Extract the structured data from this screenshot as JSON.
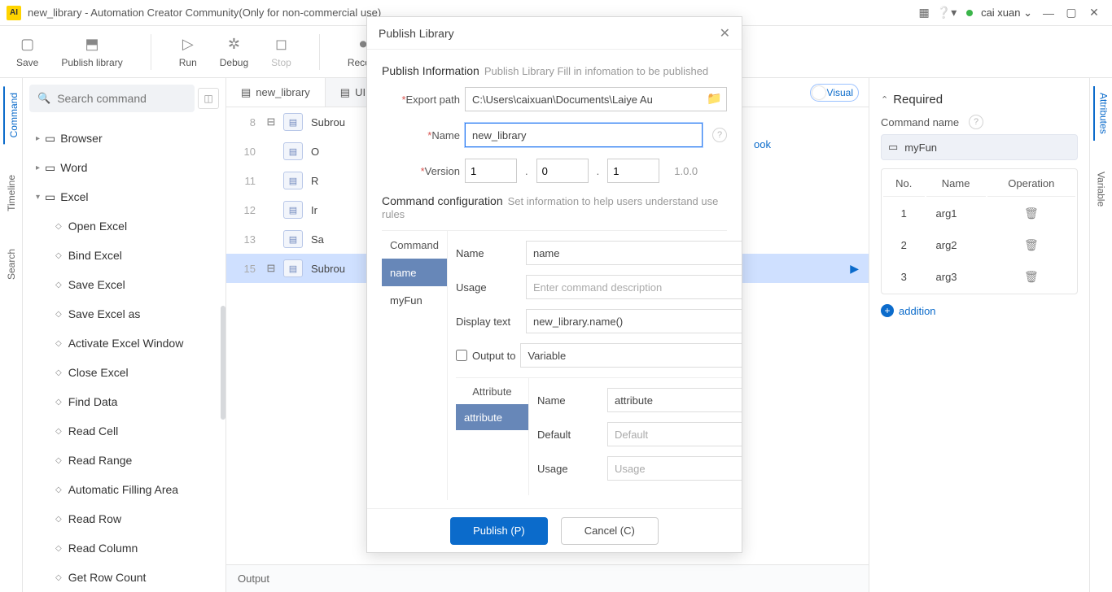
{
  "titlebar": {
    "app_badge": "AI",
    "title": "new_library - Automation Creator Community(Only for non-commercial use)",
    "user": "cai xuan"
  },
  "toolbar": {
    "save": "Save",
    "publish": "Publish library",
    "run": "Run",
    "debug": "Debug",
    "stop": "Stop",
    "record": "Record"
  },
  "leftrail": {
    "command": "Command",
    "timeline": "Timeline",
    "search": "Search"
  },
  "rightrail": {
    "attributes": "Attributes",
    "variable": "Variable"
  },
  "search": {
    "placeholder": "Search command"
  },
  "tree": {
    "browser": "Browser",
    "word": "Word",
    "excel": "Excel",
    "children": [
      "Open Excel",
      "Bind Excel",
      "Save Excel",
      "Save Excel as",
      "Activate Excel Window",
      "Close Excel",
      "Find Data",
      "Read Cell",
      "Read Range",
      "Automatic Filling Area",
      "Read Row",
      "Read Column",
      "Get Row Count"
    ]
  },
  "tabs": {
    "t1": "new_library",
    "t2": "UI Lib",
    "visual": "Visual"
  },
  "code": {
    "lines": [
      {
        "n": "8",
        "txt": "Subrou"
      },
      {
        "n": "10",
        "txt": "O"
      },
      {
        "n": "11",
        "txt": "R"
      },
      {
        "n": "12",
        "txt": "Ir"
      },
      {
        "n": "13",
        "txt": "Sa"
      },
      {
        "n": "15",
        "txt": "Subrou"
      }
    ],
    "right_tag": "ook"
  },
  "output": {
    "label": "Output"
  },
  "attrs": {
    "heading": "Required",
    "command_name_label": "Command name",
    "command_name": "myFun",
    "cols": {
      "no": "No.",
      "name": "Name",
      "op": "Operation"
    },
    "rows": [
      {
        "no": "1",
        "name": "arg1"
      },
      {
        "no": "2",
        "name": "arg2"
      },
      {
        "no": "3",
        "name": "arg3"
      }
    ],
    "addition": "addition"
  },
  "modal": {
    "title": "Publish Library",
    "pub_info": "Publish Information",
    "pub_hint": "Publish Library Fill in infomation to be published",
    "export_path_label": "Export path",
    "export_path": "C:\\Users\\caixuan\\Documents\\Laiye Au",
    "name_label": "Name",
    "name_value": "new_library",
    "version_label": "Version",
    "version": {
      "major": "1",
      "minor": "0",
      "patch": "1",
      "full": "1.0.0"
    },
    "cmd_cfg": "Command configuration",
    "cmd_cfg_hint": "Set information to help users understand use rules",
    "cmd_list_hd": "Command",
    "cmd_items": [
      "name",
      "myFun"
    ],
    "cmd_name_label": "Name",
    "cmd_name_value": "name",
    "cmd_usage_label": "Usage",
    "cmd_usage_ph": "Enter command description",
    "cmd_display_label": "Display text",
    "cmd_display_value": "new_library.name()",
    "cmd_output_label": "Output to",
    "cmd_output_value": "Variable",
    "attr_hd": "Attribute",
    "attr_items": [
      "attribute"
    ],
    "attr_name_label": "Name",
    "attr_name_value": "attribute",
    "attr_default_label": "Default",
    "attr_default_ph": "Default",
    "attr_usage_label": "Usage",
    "attr_usage_ph": "Usage",
    "publish_btn": "Publish (P)",
    "cancel_btn": "Cancel (C)"
  }
}
